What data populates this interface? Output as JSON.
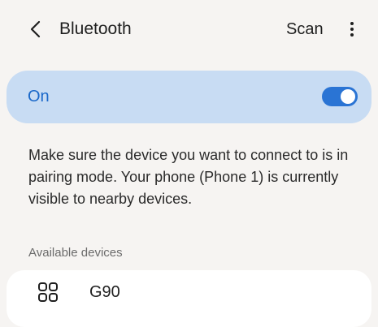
{
  "header": {
    "back_icon": "chevron-left-icon",
    "title": "Bluetooth",
    "scan_label": "Scan",
    "more_icon": "more-vertical-icon"
  },
  "toggle_card": {
    "label": "On",
    "enabled": true,
    "accent_color": "#2a74d4",
    "card_color": "#c8dcf3"
  },
  "description": "Make sure the device you want to connect to is in pairing mode. Your phone (Phone 1) is currently visible to nearby devices.",
  "available": {
    "section_label": "Available devices",
    "devices": [
      {
        "icon": "device-grid-icon",
        "name": "G90"
      }
    ]
  }
}
